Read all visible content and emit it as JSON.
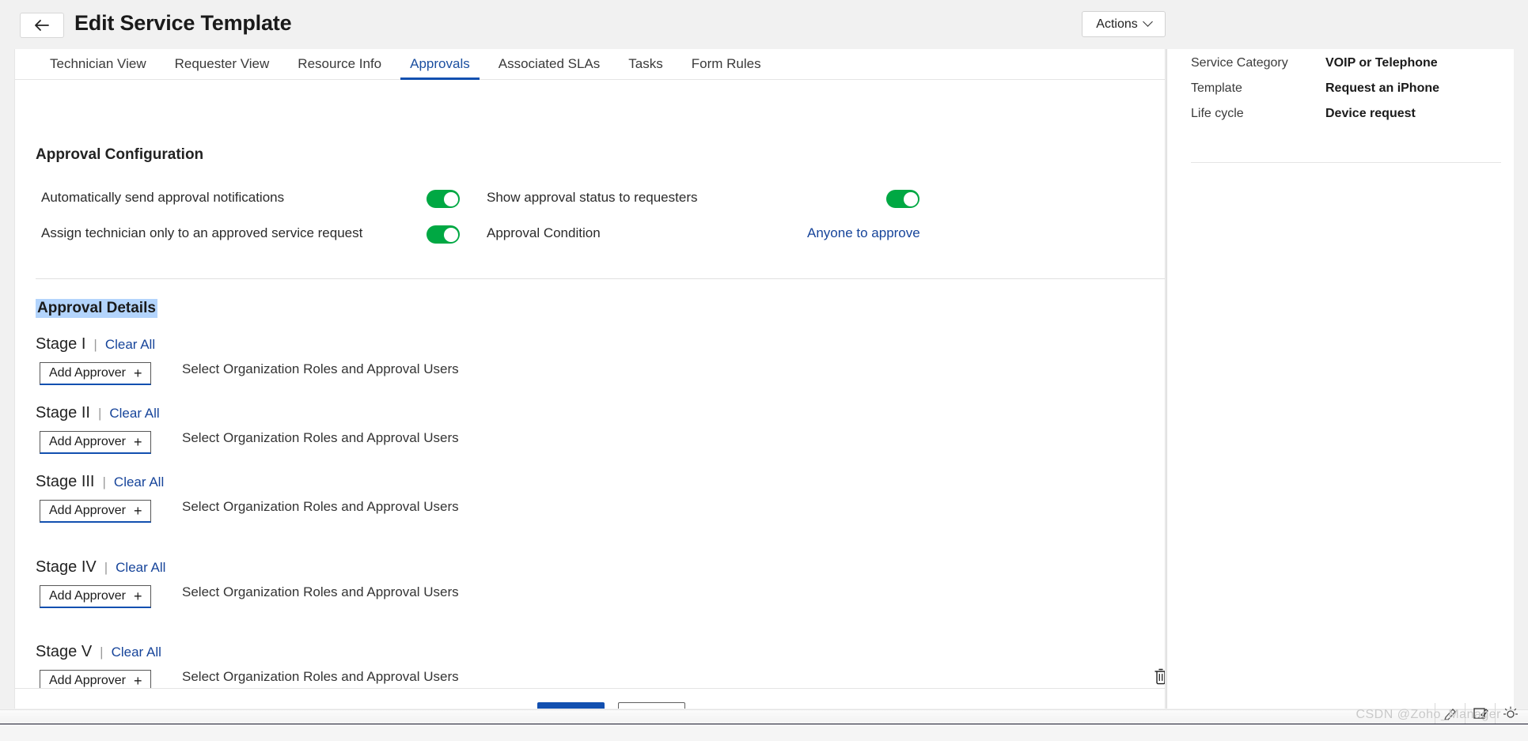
{
  "header": {
    "back_icon": "arrow-left-icon",
    "title": "Edit Service Template",
    "actions_label": "Actions",
    "actions_caret_icon": "chevron-down-icon"
  },
  "tabs": [
    {
      "label": "Technician View",
      "active": false
    },
    {
      "label": "Requester View",
      "active": false
    },
    {
      "label": "Resource Info",
      "active": false
    },
    {
      "label": "Approvals",
      "active": true
    },
    {
      "label": "Associated SLAs",
      "active": false
    },
    {
      "label": "Tasks",
      "active": false
    },
    {
      "label": "Form Rules",
      "active": false
    }
  ],
  "approval_configuration": {
    "section_title": "Approval Configuration",
    "settings": [
      {
        "label": "Automatically send approval notifications",
        "toggle": "on"
      },
      {
        "label": "Show approval status to requesters",
        "toggle": "on"
      },
      {
        "label": "Assign technician only to an approved service request",
        "toggle": "on"
      },
      {
        "label": "Approval Condition",
        "link": "Anyone to approve"
      }
    ]
  },
  "approval_details": {
    "title": "Approval Details",
    "separator": "|",
    "clear_all_label": "Clear All",
    "add_approver_label": "Add Approver",
    "add_approver_icon": "plus-icon",
    "hint_text": "Select Organization Roles and Approval Users",
    "delete_icon": "trash-icon",
    "stages": [
      {
        "name": "Stage I"
      },
      {
        "name": "Stage II"
      },
      {
        "name": "Stage III"
      },
      {
        "name": "Stage IV"
      },
      {
        "name": "Stage V"
      }
    ]
  },
  "right_panel": {
    "rows": [
      {
        "label": "Service Category",
        "value": "VOIP or Telephone"
      },
      {
        "label": "Template",
        "value": "Request an iPhone"
      },
      {
        "label": "Life cycle",
        "value": "Device request"
      }
    ]
  },
  "statusbar": {
    "watermark": "CSDN @Zoho_Manager",
    "tray_icons": [
      "pen-edit-icon",
      "note-edit-icon",
      "brightness-icon"
    ]
  },
  "colors": {
    "accent_blue": "#1250b0",
    "link_blue": "#16449a",
    "toggle_green": "#00a843",
    "selection_blue": "#b3d4fc"
  }
}
